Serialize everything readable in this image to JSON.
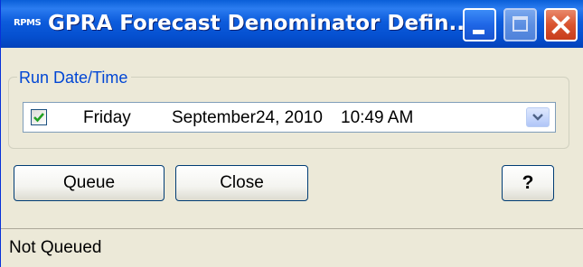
{
  "window": {
    "app_icon_text": "RPMS",
    "title": "GPRA Forecast Denominator Defin..."
  },
  "run_date_group": {
    "label": "Run Date/Time",
    "checked": true,
    "day": "Friday",
    "date": "September24, 2010",
    "time": "10:49 AM"
  },
  "buttons": {
    "queue_label": "Queue",
    "close_label": "Close",
    "help_label": "?"
  },
  "status_bar": {
    "text": "Not Queued"
  },
  "colors": {
    "titlebar": "#0550d0",
    "group_label": "#0046d5",
    "window_bg": "#ece9d8",
    "close_button": "#d9532f"
  },
  "icons": {
    "app": "rpms-app-icon",
    "minimize": "minimize-icon",
    "maximize": "maximize-icon",
    "close": "close-icon",
    "check": "checkmark-icon",
    "dropdown": "chevron-down-icon"
  }
}
